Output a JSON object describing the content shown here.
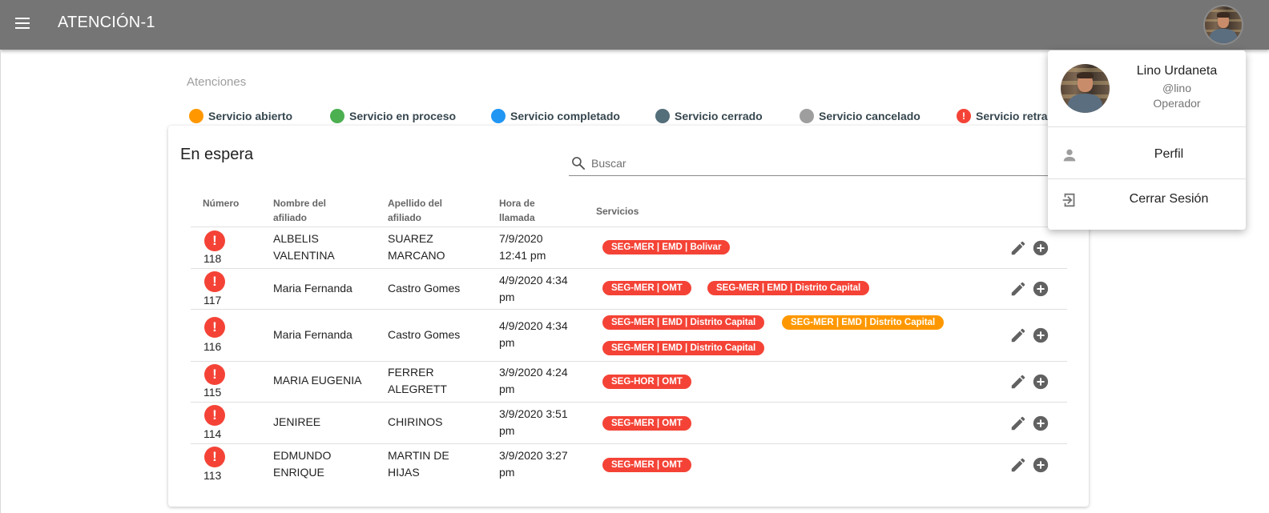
{
  "app": {
    "title": "ATENCIÓN-1"
  },
  "page": {
    "breadcrumb": "Atenciones"
  },
  "legend": [
    {
      "label": "Servicio abierto",
      "color": "#ff9800",
      "icon": "circle"
    },
    {
      "label": "Servicio en proceso",
      "color": "#4caf50",
      "icon": "circle"
    },
    {
      "label": "Servicio completado",
      "color": "#2196f3",
      "icon": "circle"
    },
    {
      "label": "Servicio cerrado",
      "color": "#546e7a",
      "icon": "circle"
    },
    {
      "label": "Servicio cancelado",
      "color": "#9e9e9e",
      "icon": "circle"
    },
    {
      "label": "Servicio retrasado",
      "color": "#f44336",
      "icon": "alert-icon"
    }
  ],
  "queue": {
    "title": "En espera",
    "search_placeholder": "Buscar",
    "columns": {
      "number": "Número",
      "first_name": "Nombre del afiliado",
      "last_name": "Apellido del afiliado",
      "call_time": "Hora de llamada",
      "services": "Servicios"
    },
    "rows": [
      {
        "number": "118",
        "first_name": "ALBELIS VALENTINA",
        "last_name": "SUAREZ MARCANO",
        "call_time": "7/9/2020 12:41 pm",
        "services": [
          {
            "label": "SEG-MER | EMD | Bolivar",
            "color": "#f44336"
          }
        ]
      },
      {
        "number": "117",
        "first_name": "Maria Fernanda",
        "last_name": "Castro Gomes",
        "call_time": "4/9/2020 4:34 pm",
        "services": [
          {
            "label": "SEG-MER | OMT",
            "color": "#f44336"
          },
          {
            "label": "SEG-MER | EMD | Distrito Capital",
            "color": "#f44336"
          }
        ]
      },
      {
        "number": "116",
        "first_name": "Maria Fernanda",
        "last_name": "Castro Gomes",
        "call_time": "4/9/2020 4:34 pm",
        "services": [
          {
            "label": "SEG-MER | EMD | Distrito Capital",
            "color": "#f44336"
          },
          {
            "label": "SEG-MER | EMD | Distrito Capital",
            "color": "#ff9800"
          },
          {
            "label": "SEG-MER | EMD | Distrito Capital",
            "color": "#f44336"
          }
        ]
      },
      {
        "number": "115",
        "first_name": "MARIA EUGENIA",
        "last_name": "FERRER ALEGRETT",
        "call_time": "3/9/2020 4:24 pm",
        "services": [
          {
            "label": "SEG-HOR | OMT",
            "color": "#f44336"
          }
        ]
      },
      {
        "number": "114",
        "first_name": "JENIREE",
        "last_name": "CHIRINOS",
        "call_time": "3/9/2020 3:51 pm",
        "services": [
          {
            "label": "SEG-MER | OMT",
            "color": "#f44336"
          }
        ]
      },
      {
        "number": "113",
        "first_name": "EDMUNDO ENRIQUE",
        "last_name": "MARTIN DE HIJAS",
        "call_time": "3/9/2020 3:27 pm",
        "services": [
          {
            "label": "SEG-MER | OMT",
            "color": "#f44336"
          }
        ]
      }
    ]
  },
  "user_menu": {
    "name": "Lino Urdaneta",
    "username": "@lino",
    "role": "Operador",
    "items": [
      {
        "label": "Perfil",
        "icon": "person-icon"
      },
      {
        "label": "Cerrar Sesión",
        "icon": "logout-icon"
      }
    ]
  }
}
